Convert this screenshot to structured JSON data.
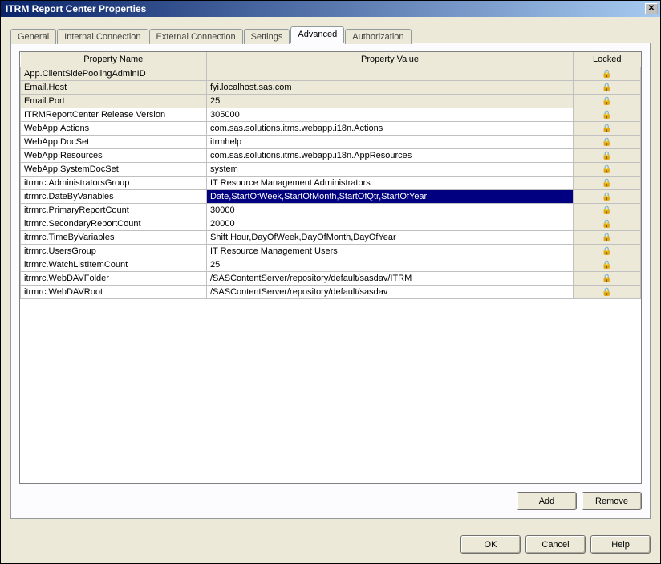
{
  "window": {
    "title": "ITRM Report Center Properties"
  },
  "tabs": [
    {
      "label": "General"
    },
    {
      "label": "Internal Connection"
    },
    {
      "label": "External Connection"
    },
    {
      "label": "Settings"
    },
    {
      "label": "Advanced",
      "active": true
    },
    {
      "label": "Authorization"
    }
  ],
  "columns": {
    "name": "Property Name",
    "value": "Property Value",
    "locked": "Locked"
  },
  "rows": [
    {
      "name": "App.ClientSidePoolingAdminID",
      "value": "",
      "locked": true,
      "shaded": true
    },
    {
      "name": "Email.Host",
      "value": "fyi.localhost.sas.com",
      "locked": true,
      "shaded": true
    },
    {
      "name": "Email.Port",
      "value": "25",
      "locked": true,
      "shaded": true
    },
    {
      "name": "ITRMReportCenter Release Version",
      "value": "305000",
      "locked": true
    },
    {
      "name": "WebApp.Actions",
      "value": "com.sas.solutions.itms.webapp.i18n.Actions",
      "locked": true
    },
    {
      "name": "WebApp.DocSet",
      "value": "itrmhelp",
      "locked": true
    },
    {
      "name": "WebApp.Resources",
      "value": "com.sas.solutions.itms.webapp.i18n.AppResources",
      "locked": true
    },
    {
      "name": "WebApp.SystemDocSet",
      "value": "system",
      "locked": true
    },
    {
      "name": "itrmrc.AdministratorsGroup",
      "value": "IT Resource Management Administrators",
      "locked": true
    },
    {
      "name": "itrmrc.DateByVariables",
      "value": "Date,StartOfWeek,StartOfMonth,StartOfQtr,StartOfYear",
      "locked": true,
      "selected": true
    },
    {
      "name": "itrmrc.PrimaryReportCount",
      "value": "30000",
      "locked": true
    },
    {
      "name": "itrmrc.SecondaryReportCount",
      "value": "20000",
      "locked": true
    },
    {
      "name": "itrmrc.TimeByVariables",
      "value": "Shift,Hour,DayOfWeek,DayOfMonth,DayOfYear",
      "locked": true
    },
    {
      "name": "itrmrc.UsersGroup",
      "value": "IT Resource Management Users",
      "locked": true
    },
    {
      "name": "itrmrc.WatchListItemCount",
      "value": "25",
      "locked": true
    },
    {
      "name": "itrmrc.WebDAVFolder",
      "value": "/SASContentServer/repository/default/sasdav/ITRM",
      "locked": true
    },
    {
      "name": "itrmrc.WebDAVRoot",
      "value": "/SASContentServer/repository/default/sasdav",
      "locked": true
    }
  ],
  "panelButtons": {
    "add": "Add",
    "remove": "Remove"
  },
  "dialogButtons": {
    "ok": "OK",
    "cancel": "Cancel",
    "help": "Help"
  }
}
